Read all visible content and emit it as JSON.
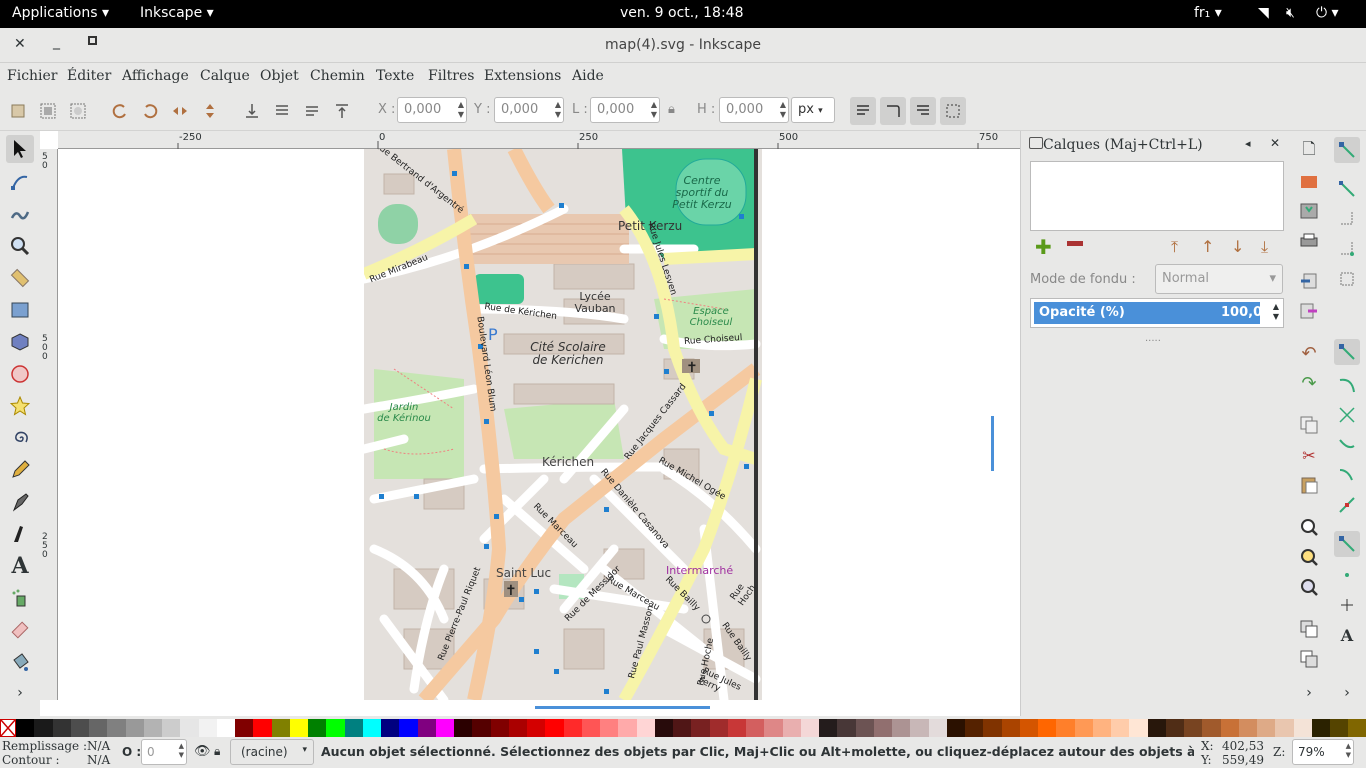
{
  "topbar": {
    "applications": "Applications",
    "app": "Inkscape",
    "datetime": "ven.  9 oct., 18:48",
    "lang": "fr₁"
  },
  "window": {
    "title": "map(4).svg - Inkscape"
  },
  "menu": [
    "Fichier",
    "Éditer",
    "Affichage",
    "Calque",
    "Objet",
    "Chemin",
    "Texte",
    "Filtres",
    "Extensions",
    "Aide"
  ],
  "toolbar": {
    "x_label": "X :",
    "x_value": "0,000",
    "y_label": "Y :",
    "y_value": "0,000",
    "w_label": "L :",
    "w_value": "0,000",
    "h_label": "H :",
    "h_value": "0,000",
    "unit": "px"
  },
  "ruler": {
    "h_ticks": [
      "-250",
      "0",
      "250",
      "500",
      "750"
    ],
    "v_ticks": [
      "5\n0",
      "5\n0\n0",
      "2\n5\n0"
    ]
  },
  "map_labels": {
    "centre": "Centre\nsportif du\nPetit Kerzu",
    "petit_kerzu": "Petit Kerzu",
    "lycee": "Lycée\nVauban",
    "espace": "Espace\nChoiseul",
    "cite": "Cité Scolaire\nde Kerichen",
    "jardin": "Jardin\nde Kérinou",
    "kerichen": "Kérichen",
    "saint_luc": "Saint Luc",
    "intermarche": "Intermarché",
    "rue_bertrand": "Rue Bertrand d'Argentré",
    "rue_mirabeau": "Rue Mirabeau",
    "rue_jules_lesven": "Rue Jules Lesven",
    "rue_de_kerichen": "Rue de Kérichen",
    "rue_choiseul": "Rue Choiseul",
    "bd_leon_blum": "Boulevard Léon Blum",
    "rue_jacques_cassard": "Rue Jacques Cassard",
    "rue_michel_ogee": "Rue Michel Ogée",
    "rue_daniele_casanova": "Rue Danièle Casanova",
    "rue_marceau": "Rue Marceau",
    "rue_marceau2": "Rue Marceau",
    "rue_de_messidor": "Rue de Messidor",
    "rue_bailly": "Rue Bailly",
    "rue_bailly2": "Rue Bailly",
    "rue_hoch": "Rue Hoch",
    "rue_hoche": "Rue Hoche",
    "rue_paul_masson": "Rue Paul Masson",
    "rue_pierre_paul_riquet": "Rue Pierre-Paul Riquet",
    "rue_jules_ferry": "Rue Jules Ferry",
    "parking": "P"
  },
  "dock": {
    "title": "Calques (Maj+Ctrl+L)",
    "blend_label": "Mode de fondu :",
    "blend_value": "Normal",
    "opacity_label": "Opacité (%)",
    "opacity_value": "100,0"
  },
  "status": {
    "fill_label": "Remplissage :",
    "fill_value": "N/A",
    "stroke_label": "Contour :",
    "stroke_value": "N/A",
    "o_label": "O :",
    "o_value": "0",
    "layer": "(racine)",
    "message": "Aucun objet sélectionné. Sélectionnez des objets par Clic, Maj+Clic ou Alt+molette, ou cliquez-déplacez autour des objets à sélec.",
    "x_label": "X:",
    "x_value": "402,53",
    "y_label": "Y:",
    "y_value": "559,49",
    "z_label": "Z:",
    "zoom": "79%"
  },
  "palette_colors": [
    "#000000",
    "#1a1a1a",
    "#333333",
    "#4d4d4d",
    "#666666",
    "#808080",
    "#999999",
    "#b3b3b3",
    "#cccccc",
    "#e6e6e6",
    "#f2f2f2",
    "#ffffff",
    "#800000",
    "#ff0000",
    "#808000",
    "#ffff00",
    "#008000",
    "#00ff00",
    "#008080",
    "#00ffff",
    "#000080",
    "#0000ff",
    "#800080",
    "#ff00ff",
    "#2b0000",
    "#550000",
    "#800000",
    "#aa0000",
    "#d40000",
    "#ff0000",
    "#ff2a2a",
    "#ff5555",
    "#ff8080",
    "#ffaaaa",
    "#ffd5d5",
    "#280b0b",
    "#501616",
    "#782121",
    "#a02c2c",
    "#c83737",
    "#d35f5f",
    "#de8787",
    "#e9afaf",
    "#f4d7d7",
    "#241c1c",
    "#483737",
    "#6c5353",
    "#916f6f",
    "#ac9393",
    "#c8b7b7",
    "#e3dbdb",
    "#2b1100",
    "#552200",
    "#803300",
    "#aa4400",
    "#d45500",
    "#ff6600",
    "#ff7f2a",
    "#ff9955",
    "#ffb380",
    "#ffccaa",
    "#ffe6d5",
    "#28170b",
    "#502d16",
    "#784421",
    "#a05a2c",
    "#c87137",
    "#d38d5f",
    "#deaa87",
    "#e9c6af",
    "#f4e3d7",
    "#2b2200",
    "#554400",
    "#806600"
  ]
}
